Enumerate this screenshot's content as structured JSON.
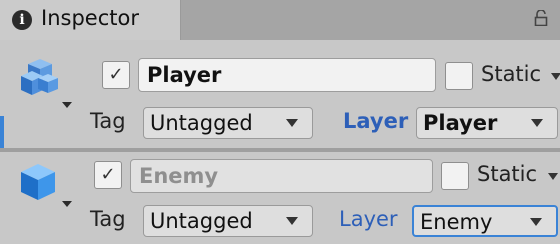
{
  "tab": {
    "icon": "info-icon",
    "icon_glyph": "i",
    "label": "Inspector"
  },
  "lock_icon": "lock-icon",
  "objects": [
    {
      "name": "Player",
      "active": true,
      "active_mark": "✓",
      "static_label": "Static",
      "static_checked": false,
      "tag_label": "Tag",
      "tag_value": "Untagged",
      "layer_label": "Layer",
      "layer_value": "Player",
      "selected": true
    },
    {
      "name": "Enemy",
      "active": true,
      "active_mark": "✓",
      "static_label": "Static",
      "static_checked": false,
      "tag_label": "Tag",
      "tag_value": "Untagged",
      "layer_label": "Layer",
      "layer_value": "Enemy",
      "selected": false
    }
  ],
  "colors": {
    "accent": "#3a83d6",
    "layer_label": "#2d5fb8",
    "cube_multi": "#4a90e2",
    "cube_single": "#1e88e5"
  }
}
